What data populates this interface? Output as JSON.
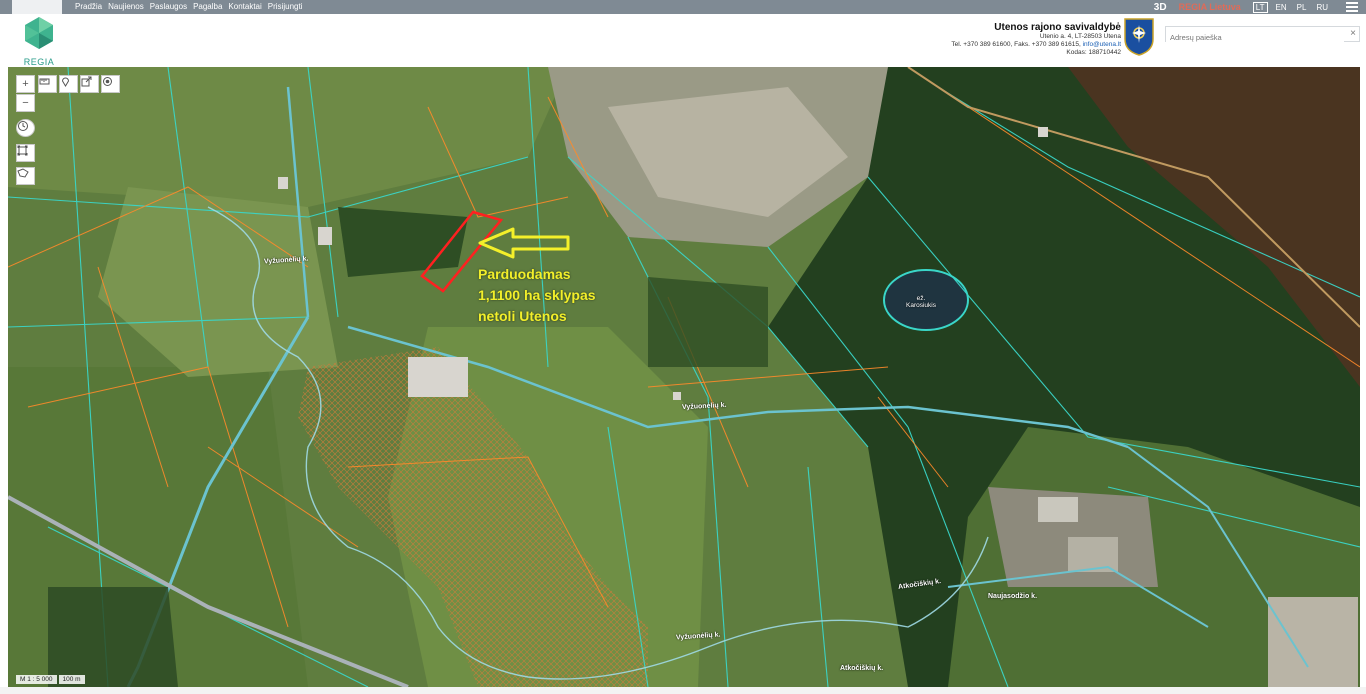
{
  "nav": {
    "items": [
      "Pradžia",
      "Naujienos",
      "Paslaugos",
      "Pagalba",
      "Kontaktai",
      "Prisijungti"
    ],
    "view_3d": "3D",
    "regia_lietuva": "REGIA Lietuva",
    "languages": [
      "LT",
      "EN",
      "PL",
      "RU"
    ],
    "active_language": "LT"
  },
  "brand": {
    "name": "REGIA",
    "color": "#2a9c8a"
  },
  "municipality": {
    "name": "Utenos rajono savivaldybė",
    "address": "Utenio a. 4, LT-28503 Utena",
    "phone": "Tel. +370 389 61600, Faks. +370 389 61615,",
    "email": "info@utena.lt",
    "code": "Kodas: 188710442"
  },
  "search": {
    "placeholder": "Adresų paieška",
    "clear": "×"
  },
  "map": {
    "ad_lines": [
      "Parduodamas",
      "1,1100 ha sklypas",
      "netoli Utenos"
    ],
    "lake_label": [
      "ež.",
      "Karosiukis"
    ],
    "road_labels": [
      "Vyžuonėlių k.",
      "Vyžuonėlių k.",
      "Vyžuonėlių k.",
      "Atkočiškių k.",
      "Atkočiškių k.",
      "Naujasodžio k."
    ],
    "scale_ratio": "M 1 : 5 000",
    "scale_bar": "100 m",
    "colors": {
      "parcel_line": "#3ad6c8",
      "cadastre_line": "#ff8a2a",
      "highlight": "#ff2020",
      "arrow": "#f4f02a"
    }
  },
  "tools": {
    "zoom_in": "+",
    "zoom_out": "−"
  }
}
